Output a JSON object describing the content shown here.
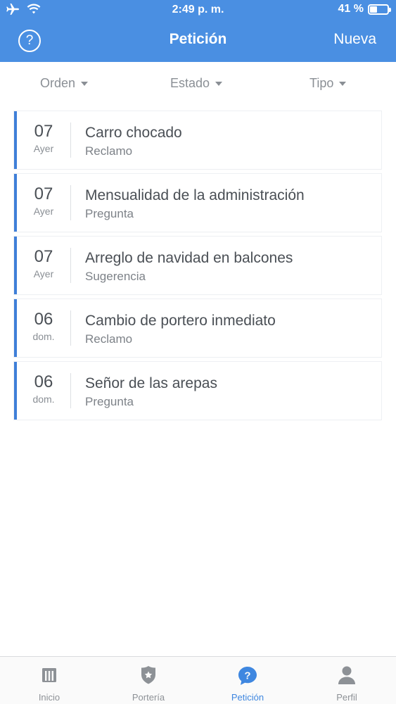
{
  "status_bar": {
    "time": "2:49 p. m.",
    "battery": "41 %",
    "battery_level": 0.41
  },
  "navbar": {
    "help_symbol": "?",
    "title": "Petición",
    "new_label": "Nueva"
  },
  "filters": [
    {
      "label": "Orden"
    },
    {
      "label": "Estado"
    },
    {
      "label": "Tipo"
    }
  ],
  "requests": [
    {
      "day": "07",
      "weekday": "Ayer",
      "title": "Carro chocado",
      "type": "Reclamo"
    },
    {
      "day": "07",
      "weekday": "Ayer",
      "title": "Mensualidad de la administración",
      "type": "Pregunta"
    },
    {
      "day": "07",
      "weekday": "Ayer",
      "title": "Arreglo de navidad en balcones",
      "type": "Sugerencia"
    },
    {
      "day": "06",
      "weekday": "dom.",
      "title": "Cambio de portero inmediato",
      "type": "Reclamo"
    },
    {
      "day": "06",
      "weekday": "dom.",
      "title": "Señor de las arepas",
      "type": "Pregunta"
    }
  ],
  "tabs": [
    {
      "label": "Inicio",
      "icon": "building-icon",
      "active": false
    },
    {
      "label": "Portería",
      "icon": "badge-icon",
      "active": false
    },
    {
      "label": "Petición",
      "icon": "question-bubble-icon",
      "active": true
    },
    {
      "label": "Perfil",
      "icon": "person-icon",
      "active": false
    }
  ],
  "colors": {
    "accent": "#4a8fe2",
    "card_border": "#3f7fd8",
    "tab_active": "#3f87e0",
    "tab_inactive": "#8d9196"
  }
}
